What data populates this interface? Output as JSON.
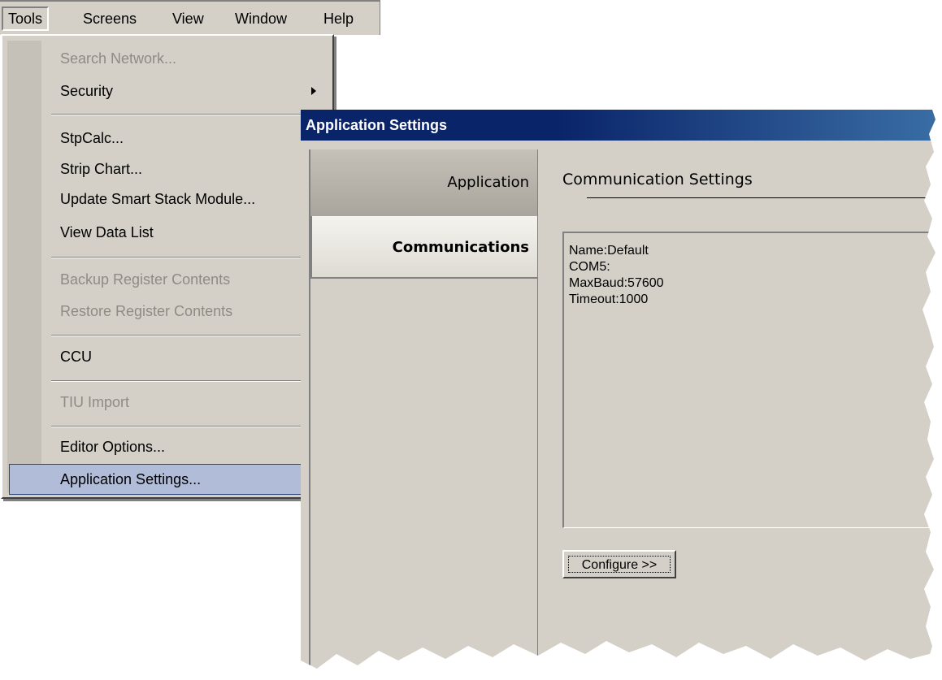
{
  "menubar": {
    "items": [
      {
        "label": "Tools"
      },
      {
        "label": "Screens"
      },
      {
        "label": "View"
      },
      {
        "label": "Window"
      },
      {
        "label": "Help"
      }
    ]
  },
  "tools_menu": {
    "items": [
      {
        "label": "Search Network...",
        "disabled": true
      },
      {
        "label": "Security",
        "submenu": true
      },
      {
        "label": "StpCalc..."
      },
      {
        "label": "Strip Chart..."
      },
      {
        "label": "Update Smart Stack Module..."
      },
      {
        "label": "View Data List"
      },
      {
        "label": "Backup Register Contents",
        "disabled": true
      },
      {
        "label": "Restore Register Contents",
        "disabled": true
      },
      {
        "label": "CCU"
      },
      {
        "label": "TIU Import",
        "disabled": true
      },
      {
        "label": "Editor Options..."
      },
      {
        "label": "Application Settings...",
        "highlighted": true
      }
    ]
  },
  "settings_window": {
    "title": "Application Settings",
    "tabs": [
      {
        "label": "Application"
      },
      {
        "label": "Communications",
        "selected": true
      }
    ],
    "section_heading": "Communication Settings",
    "details": [
      "Name:Default",
      "COM5:",
      "MaxBaud:57600",
      "Timeout:1000"
    ],
    "configure_button": "Configure >>"
  },
  "colors": {
    "face": "#d4d0c8",
    "titlebar": "#0a246a",
    "menu_highlight": "#b1bcd9",
    "disabled_text": "#8e8b85"
  }
}
